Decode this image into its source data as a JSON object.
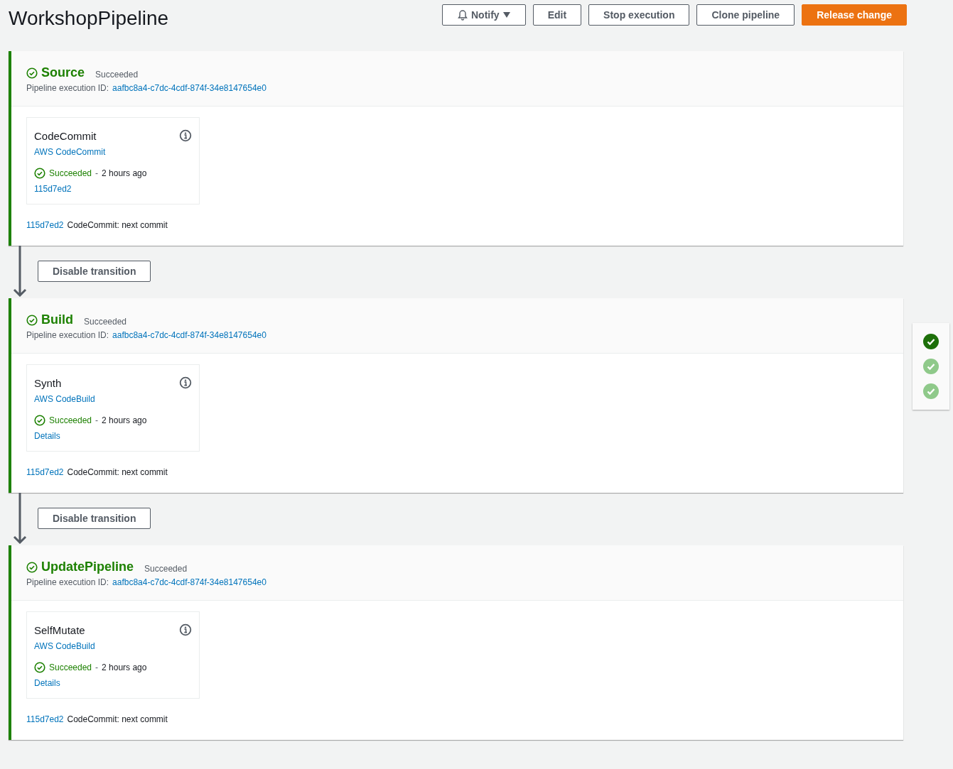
{
  "title": "WorkshopPipeline",
  "toolbar": [
    {
      "label": "Notify",
      "kind": "dropdown"
    },
    {
      "label": "Edit",
      "kind": "normal"
    },
    {
      "label": "Stop execution",
      "kind": "normal"
    },
    {
      "label": "Clone pipeline",
      "kind": "normal"
    },
    {
      "label": "Release change",
      "kind": "primary"
    }
  ],
  "stages": [
    {
      "name": "Source",
      "status": "Succeeded",
      "color": "#1d8102",
      "execution_label": "Pipeline execution ID:",
      "execution_id": "aafbc8a4-c7dc-4cdf-874f-34e8147654e0",
      "action": {
        "name": "CodeCommit",
        "provider": "AWS CodeCommit",
        "status": "Succeeded",
        "color": "#1d8102",
        "separator": "-",
        "time": "2 hours ago",
        "link": "115d7ed2"
      },
      "commit_id": "115d7ed2",
      "commit_message": "CodeCommit: next commit",
      "transition": "Disable transition"
    },
    {
      "name": "Build",
      "status": "Succeeded",
      "color": "#1d8102",
      "execution_label": "Pipeline execution ID:",
      "execution_id": "aafbc8a4-c7dc-4cdf-874f-34e8147654e0",
      "action": {
        "name": "Synth",
        "provider": "AWS CodeBuild",
        "status": "Succeeded",
        "color": "#1d8102",
        "separator": "-",
        "time": "2 hours ago",
        "link": "Details"
      },
      "commit_id": "115d7ed2",
      "commit_message": "CodeCommit: next commit",
      "transition": "Disable transition"
    },
    {
      "name": "UpdatePipeline",
      "status": "Succeeded",
      "color": "#1d8102",
      "execution_label": "Pipeline execution ID:",
      "execution_id": "aafbc8a4-c7dc-4cdf-874f-34e8147654e0",
      "action": {
        "name": "SelfMutate",
        "provider": "AWS CodeBuild",
        "status": "Succeeded",
        "color": "#1d8102",
        "separator": "-",
        "time": "2 hours ago",
        "link": "Details"
      },
      "commit_id": "115d7ed2",
      "commit_message": "CodeCommit: next commit"
    }
  ],
  "navigator": [
    {
      "selected": true
    },
    {
      "selected": false
    },
    {
      "selected": false
    }
  ]
}
